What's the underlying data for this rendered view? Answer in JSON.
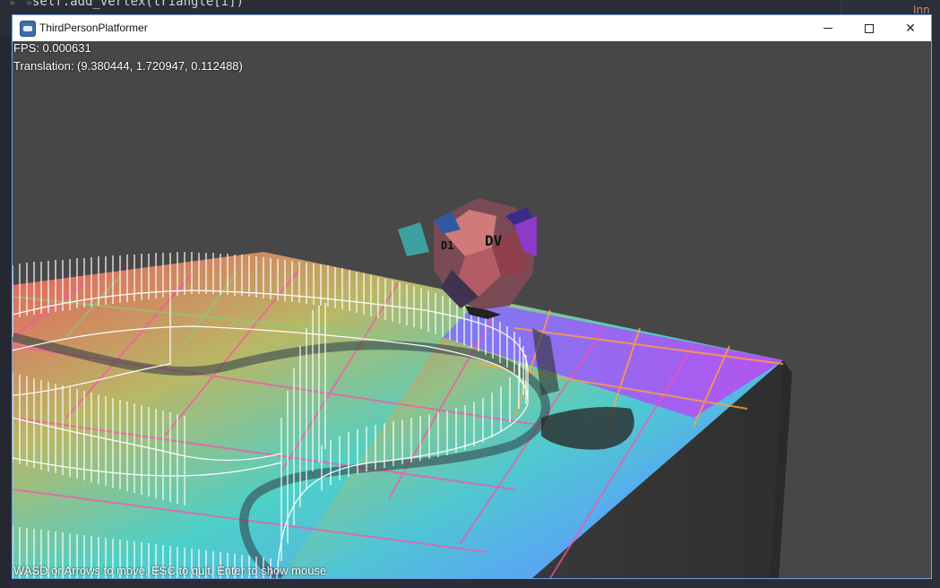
{
  "editor": {
    "code_line": "self.add_vertex(triangle[i])",
    "right_label": "Inne"
  },
  "window": {
    "title": "ThirdPersonPlatformer",
    "minimize_label": "—",
    "maximize_label": "☐",
    "close_label": "✕"
  },
  "hud": {
    "fps": "FPS: 0.000631",
    "translation": "Translation: (9.380444, 1.720947, 0.112488)",
    "help": "WASD or Arrows to move, ESC to quit, Enter to show mouse"
  },
  "scene": {
    "background_color": "#474747",
    "floor_colors": [
      "#e06060",
      "#9fc27a",
      "#4fd2cc",
      "#5aa9f0",
      "#9a5cf0",
      "#c65ce8"
    ],
    "grid_color_pink": "#ff4fa8",
    "grid_color_orange": "#ffa23c",
    "wall_color": "#3a3a3a",
    "monkey_labels": [
      "D1",
      "DV"
    ]
  }
}
